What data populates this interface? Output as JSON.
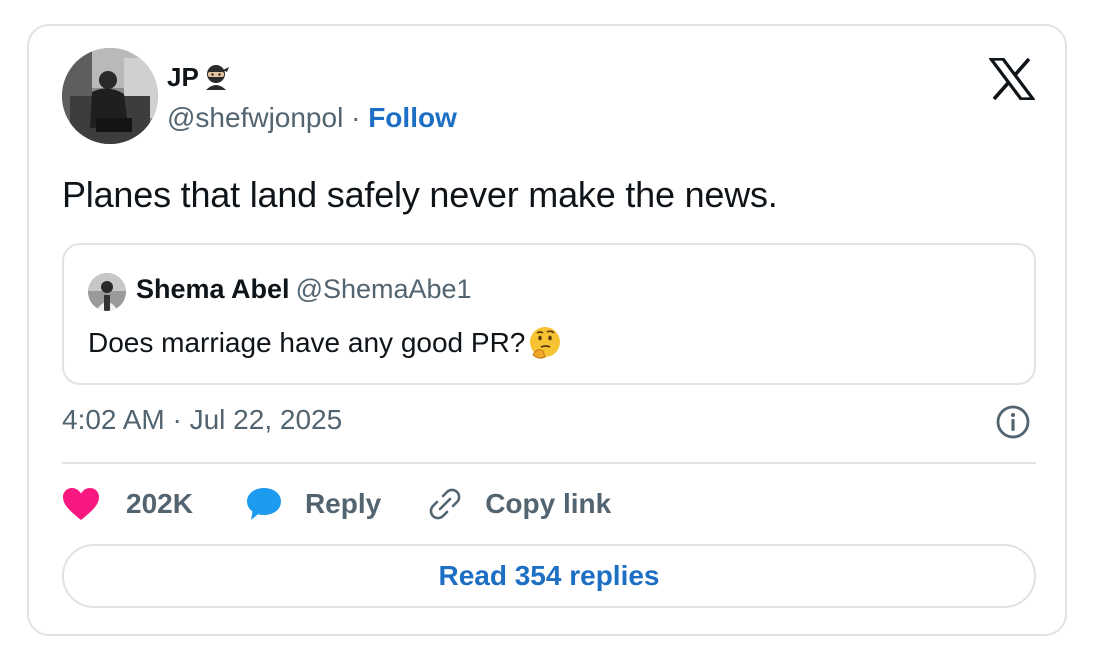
{
  "author": {
    "name": "JP",
    "handle": "@shefwjonpol",
    "separator": " · ",
    "follow_label": "Follow",
    "avatar_icon": "profile-photo-icon",
    "emoji_icon": "ninja-icon"
  },
  "brand": {
    "logo_icon": "x-logo-icon"
  },
  "tweet": {
    "text": "Planes that land safely never make the news.",
    "timestamp": "4:02 AM · Jul 22, 2025"
  },
  "quote": {
    "name": "Shema Abel",
    "handle": "@ShemaAbe1",
    "text": "Does marriage have any good PR?",
    "emoji_icon": "thinking-face-icon"
  },
  "actions": {
    "like_count": "202K",
    "reply_label": "Reply",
    "copy_label": "Copy link"
  },
  "footer": {
    "read_replies_label": "Read 354 replies"
  },
  "colors": {
    "like": "#f91880",
    "reply": "#1d9bf0",
    "link": "#1d6fc4",
    "muted": "#536471",
    "border": "#dfe3e6",
    "text": "#0f1419"
  }
}
